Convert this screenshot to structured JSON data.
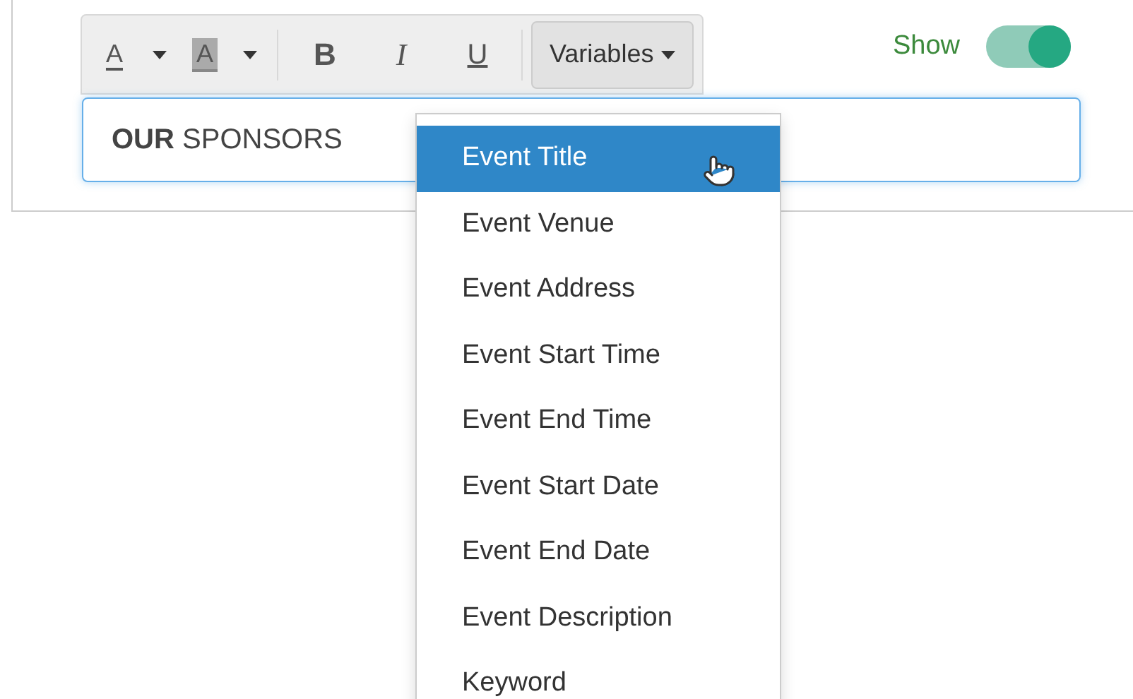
{
  "toolbar": {
    "font_color": "A",
    "highlight": "A",
    "bold": "B",
    "italic": "I",
    "underline": "U",
    "variables": "Variables"
  },
  "editor": {
    "value": "**OUR** SPONSORS"
  },
  "show_toggle": {
    "label": "Show",
    "on": true
  },
  "variables_menu": [
    {
      "label": "Event Title",
      "selected": true
    },
    {
      "label": "Event Venue",
      "selected": false
    },
    {
      "label": "Event Address",
      "selected": false
    },
    {
      "label": "Event Start Time",
      "selected": false
    },
    {
      "label": "Event End Time",
      "selected": false
    },
    {
      "label": "Event Start Date",
      "selected": false
    },
    {
      "label": "Event End Date",
      "selected": false
    },
    {
      "label": "Event Description",
      "selected": false
    },
    {
      "label": "Keyword",
      "selected": false
    }
  ]
}
